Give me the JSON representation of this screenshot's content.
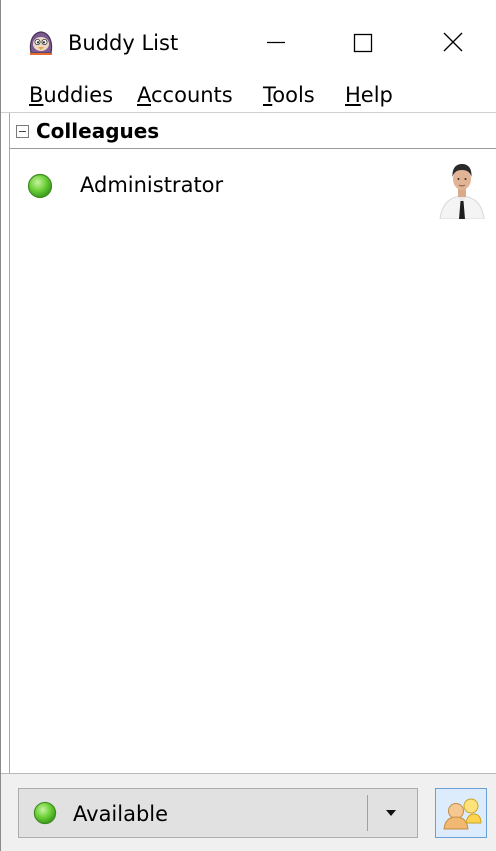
{
  "window": {
    "title": "Buddy List",
    "icon": "pidgin-icon"
  },
  "controls": {
    "minimize_icon": "minimize-icon",
    "maximize_icon": "maximize-icon",
    "close_icon": "close-icon"
  },
  "menu": [
    {
      "mnemonic": "B",
      "rest": "uddies"
    },
    {
      "mnemonic": "A",
      "rest": "ccounts"
    },
    {
      "mnemonic": "T",
      "rest": "ools"
    },
    {
      "mnemonic": "H",
      "rest": "elp"
    }
  ],
  "groups": [
    {
      "name": "Colleagues",
      "expanded": true,
      "buddies": [
        {
          "name": "Administrator",
          "status": "available",
          "avatar": "buddy-avatar"
        }
      ]
    }
  ],
  "status_bar": {
    "status_label": "Available",
    "status_color": "#4cbf2a",
    "dropdown_icon": "chevron-down-icon",
    "accounts_icon": "status-icons"
  }
}
